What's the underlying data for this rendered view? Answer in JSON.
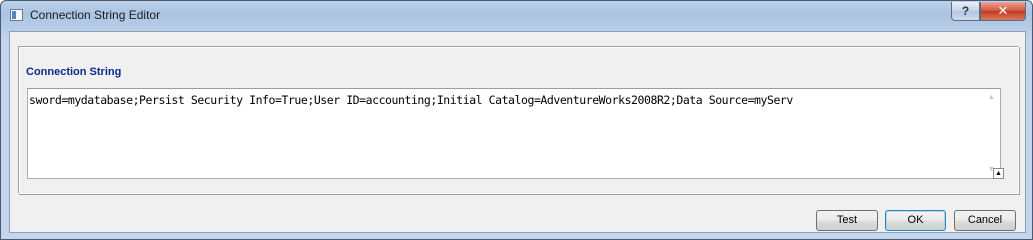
{
  "window": {
    "title": "Connection String Editor",
    "help_label": "?",
    "close_label": "✕"
  },
  "group": {
    "label": "Connection String"
  },
  "editor": {
    "value": "sword=mydatabase;Persist Security Info=True;User ID=accounting;Initial Catalog=AdventureWorks2008R2;Data Source=myServ",
    "scroll_up_glyph": "▲",
    "scroll_down_glyph": "▼",
    "resize_glyph": "▲"
  },
  "buttons": {
    "test": "Test",
    "ok": "OK",
    "cancel": "Cancel"
  },
  "colors": {
    "group_label": "#0b2b8c",
    "close_button": "#c23a20"
  }
}
